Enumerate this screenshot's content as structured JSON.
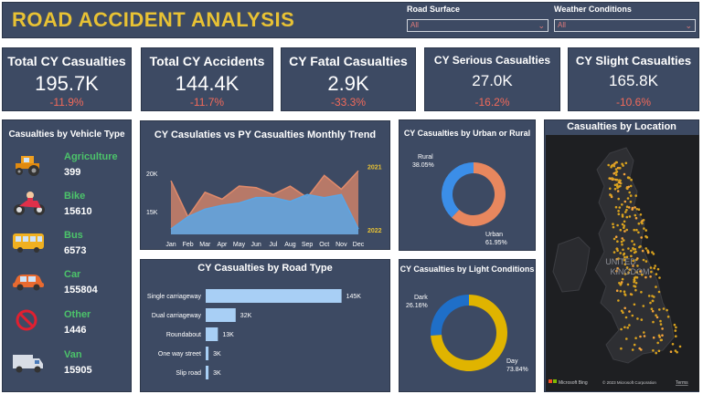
{
  "header": {
    "title": "ROAD ACCIDENT ANALYSIS",
    "road_surface_label": "Road Surface",
    "road_surface_value": "All",
    "weather_label": "Weather Conditions",
    "weather_value": "All"
  },
  "kpis": [
    {
      "title": "Total CY Casualties",
      "value": "195.7K",
      "change": "-11.9%"
    },
    {
      "title": "Total CY Accidents",
      "value": "144.4K",
      "change": "-11.7%"
    },
    {
      "title": "CY Fatal Casualties",
      "value": "2.9K",
      "change": "-33.3%"
    },
    {
      "title": "CY Serious Casualties",
      "value": "27.0K",
      "change": "-16.2%"
    },
    {
      "title": "CY Slight Casualties",
      "value": "165.8K",
      "change": "-10.6%"
    }
  ],
  "vehicle": {
    "title": "Casualties by Vehicle Type",
    "items": [
      {
        "name": "Agriculture",
        "value": "399",
        "icon": "tractor-icon"
      },
      {
        "name": "Bike",
        "value": "15610",
        "icon": "motorbike-icon"
      },
      {
        "name": "Bus",
        "value": "6573",
        "icon": "bus-icon"
      },
      {
        "name": "Car",
        "value": "155804",
        "icon": "car-icon"
      },
      {
        "name": "Other",
        "value": "1446",
        "icon": "prohibited-icon"
      },
      {
        "name": "Van",
        "value": "15905",
        "icon": "van-icon"
      }
    ]
  },
  "location": {
    "title": "Casualties by Location",
    "map_labels": [
      "UNITED",
      "KINGDOM"
    ],
    "attribution": "© 2023 Microsoft Corporation",
    "terms": "Terms",
    "brand": "Microsoft Bing"
  },
  "chart_data": [
    {
      "type": "area",
      "title": "CY Casulaties vs PY Casualties Monthly Trend",
      "categories": [
        "Jan",
        "Feb",
        "Mar",
        "Apr",
        "May",
        "Jun",
        "Jul",
        "Aug",
        "Sep",
        "Oct",
        "Nov",
        "Dec"
      ],
      "series": [
        {
          "name": "2021",
          "values": [
            19.0,
            14.3,
            17.5,
            16.6,
            18.3,
            18.1,
            17.2,
            18.3,
            16.8,
            19.7,
            17.9,
            20.3
          ]
        },
        {
          "name": "2022",
          "values": [
            12.7,
            14.3,
            15.3,
            15.8,
            16.1,
            16.8,
            16.8,
            16.3,
            17.2,
            16.8,
            17.2,
            12.7
          ]
        }
      ],
      "yticks": [
        "20K",
        "15K"
      ],
      "ylim": [
        12,
        22
      ],
      "colors": {
        "2021": "#e08a6a",
        "2022": "#5aa6e6"
      }
    },
    {
      "type": "bar",
      "title": "CY Casualties by Road Type",
      "categories": [
        "Single carriageway",
        "Dual carriageway",
        "Roundabout",
        "One way street",
        "Slip road"
      ],
      "values": [
        145,
        32,
        13,
        3,
        3
      ],
      "labels": [
        "145K",
        "32K",
        "13K",
        "3K",
        "3K"
      ],
      "xlim": [
        0,
        160
      ],
      "color": "#a8cff5"
    },
    {
      "type": "pie",
      "title": "CY Casualties by Urban or Rural",
      "categories": [
        "Rural",
        "Urban"
      ],
      "values": [
        38.05,
        61.95
      ],
      "labels": [
        "38.05%",
        "61.95%"
      ],
      "colors": [
        "#3b8ee8",
        "#e8875e"
      ]
    },
    {
      "type": "pie",
      "title": "CY Casualties by Light Conditions",
      "categories": [
        "Dark",
        "Day"
      ],
      "values": [
        26.16,
        73.84
      ],
      "labels": [
        "26.16%",
        "73.84%"
      ],
      "colors": [
        "#1f6fc8",
        "#e0b400"
      ]
    }
  ]
}
